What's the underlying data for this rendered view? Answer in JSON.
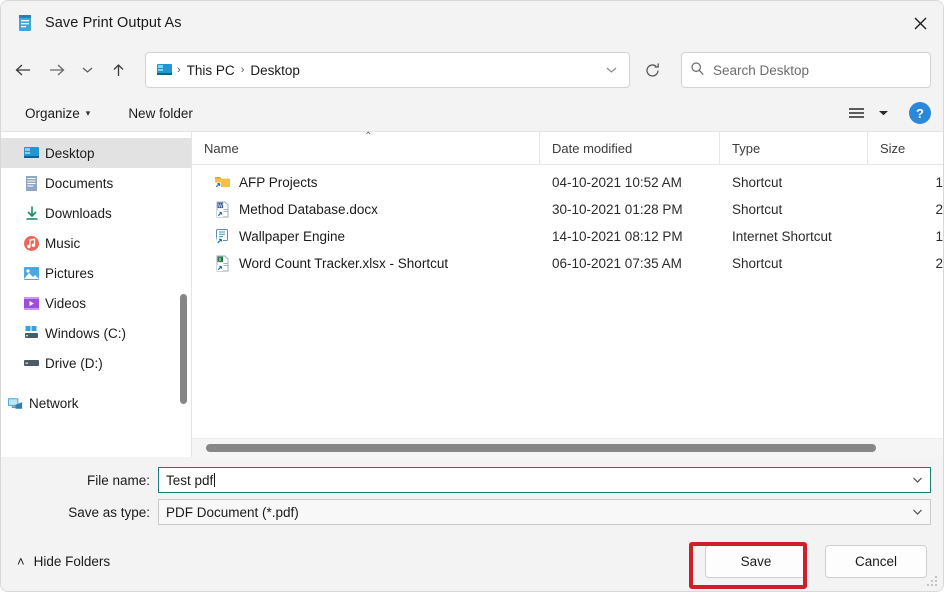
{
  "window": {
    "title": "Save Print Output As",
    "title_icon": "printer-document-icon",
    "close_label": "✕"
  },
  "nav": {
    "back_icon": "←",
    "forward_icon": "→",
    "recent_icon": "ˇ",
    "up_icon": "↑",
    "refresh_icon": "⟳",
    "address_chevron": "ˇ",
    "breadcrumbs": [
      {
        "label": "This PC"
      },
      {
        "label": "Desktop"
      }
    ],
    "separator": "›"
  },
  "search": {
    "placeholder": "Search Desktop",
    "icon": "search-icon"
  },
  "toolbar": {
    "organize_label": "Organize",
    "organize_caret": "▾",
    "new_folder_label": "New folder",
    "view_icon": "list-view-icon",
    "view_caret": "▾",
    "help_label": "?"
  },
  "sidebar": {
    "items": [
      {
        "label": "Desktop",
        "icon": "desktop-icon",
        "selected": true
      },
      {
        "label": "Documents",
        "icon": "documents-icon",
        "selected": false
      },
      {
        "label": "Downloads",
        "icon": "downloads-icon",
        "selected": false
      },
      {
        "label": "Music",
        "icon": "music-icon",
        "selected": false
      },
      {
        "label": "Pictures",
        "icon": "pictures-icon",
        "selected": false
      },
      {
        "label": "Videos",
        "icon": "videos-icon",
        "selected": false
      },
      {
        "label": "Windows (C:)",
        "icon": "windows-drive-icon",
        "selected": false
      },
      {
        "label": "Drive (D:)",
        "icon": "drive-icon",
        "selected": false
      },
      {
        "label": "Network",
        "icon": "network-icon",
        "selected": false
      }
    ]
  },
  "filelist": {
    "columns": [
      {
        "label": "Name"
      },
      {
        "label": "Date modified"
      },
      {
        "label": "Type"
      },
      {
        "label": "Size"
      }
    ],
    "sort_indicator": "⌃",
    "rows": [
      {
        "name": "AFP Projects",
        "date": "04-10-2021 10:52 AM",
        "type": "Shortcut",
        "size": "1",
        "icon": "folder-shortcut-icon"
      },
      {
        "name": "Method Database.docx",
        "date": "30-10-2021 01:28 PM",
        "type": "Shortcut",
        "size": "2",
        "icon": "word-shortcut-icon"
      },
      {
        "name": "Wallpaper Engine",
        "date": "14-10-2021 08:12 PM",
        "type": "Internet Shortcut",
        "size": "1",
        "icon": "internet-shortcut-icon"
      },
      {
        "name": "Word Count Tracker.xlsx - Shortcut",
        "date": "06-10-2021 07:35 AM",
        "type": "Shortcut",
        "size": "2",
        "icon": "excel-shortcut-icon"
      }
    ]
  },
  "form": {
    "filename_label": "File name:",
    "filename_value": "Test pdf",
    "filetype_label": "Save as type:",
    "filetype_value": "PDF Document (*.pdf)",
    "dropdown_icon": "ˇ"
  },
  "footer": {
    "hide_folders_label": "Hide Folders",
    "hide_folders_icon": "˄",
    "save_label": "Save",
    "cancel_label": "Cancel"
  },
  "annotation": {
    "highlight_color": "#d01f28",
    "highlight_target": "save-button"
  }
}
